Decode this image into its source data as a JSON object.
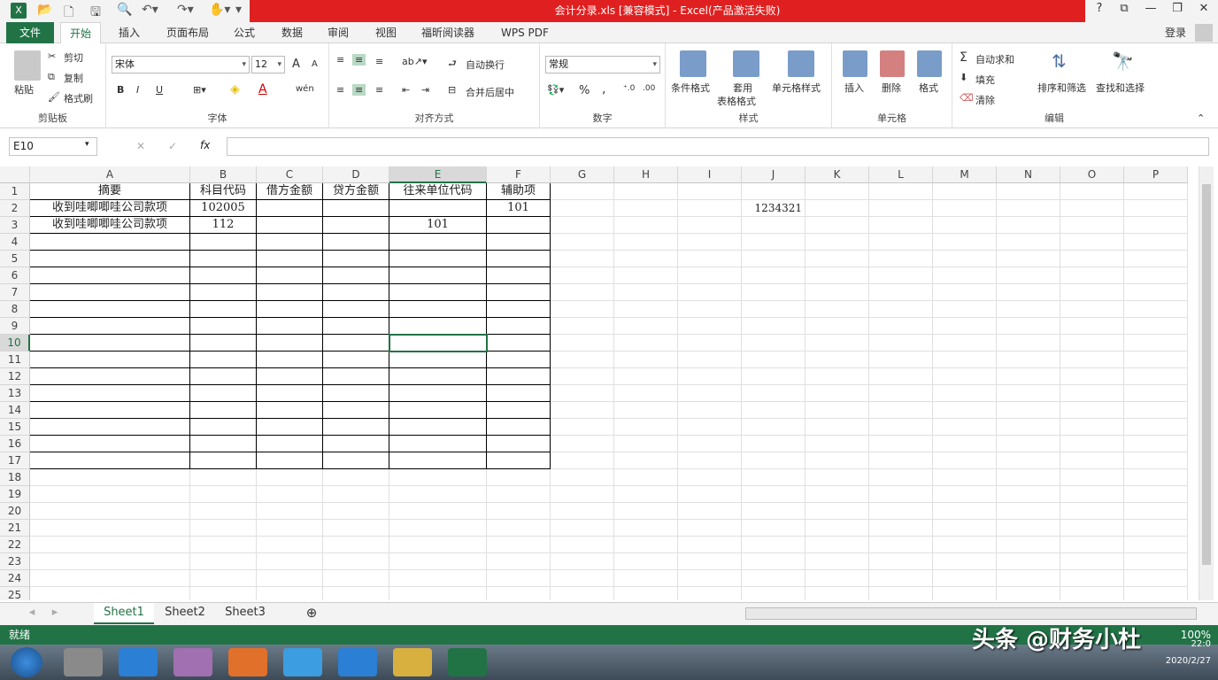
{
  "window": {
    "title": "会计分录.xls  [兼容模式] -  Excel(产品激活失败)",
    "help": "?",
    "login": "登录"
  },
  "tabs": [
    "文件",
    "开始",
    "插入",
    "页面布局",
    "公式",
    "数据",
    "审阅",
    "视图",
    "福昕阅读器",
    "WPS PDF"
  ],
  "ribbon": {
    "clipboard": {
      "label": "剪贴板",
      "paste": "粘贴",
      "cut": "剪切",
      "copy": "复制",
      "painter": "格式刷"
    },
    "font": {
      "label": "字体",
      "name": "宋体",
      "size": "12",
      "bold": "B",
      "italic": "I",
      "underline": "U",
      "grow": "A",
      "shrink": "A",
      "phonetic": "wén"
    },
    "align": {
      "label": "对齐方式",
      "wrap": "自动换行",
      "merge": "合并后居中"
    },
    "number": {
      "label": "数字",
      "format": "常规",
      "percent": "%",
      "comma": ","
    },
    "styles": {
      "label": "样式",
      "cond": "条件格式",
      "table1": "套用",
      "table2": "表格格式",
      "cell": "单元格样式"
    },
    "cells": {
      "label": "单元格",
      "insert": "插入",
      "delete": "删除",
      "format": "格式"
    },
    "edit": {
      "label": "编辑",
      "autosum": "自动求和",
      "fill": "填充",
      "clear": "清除",
      "sort": "排序和筛选",
      "find": "查找和选择"
    }
  },
  "formula": {
    "namebox": "E10",
    "fx": "fx",
    "cancel": "✕",
    "confirm": "✓"
  },
  "columns": [
    "A",
    "B",
    "C",
    "D",
    "E",
    "F",
    "G",
    "H",
    "I",
    "J",
    "K",
    "L",
    "M",
    "N",
    "O",
    "P"
  ],
  "rows": [
    "1",
    "2",
    "3",
    "4",
    "5",
    "6",
    "7",
    "8",
    "9",
    "10",
    "11",
    "12",
    "13",
    "14",
    "15",
    "16",
    "17",
    "18",
    "19",
    "20",
    "21",
    "22",
    "23",
    "24",
    "25"
  ],
  "cells": {
    "A1": "摘要",
    "B1": "科目代码",
    "C1": "借方金额",
    "D1": "贷方金额",
    "E1": "往来单位代码",
    "F1": "辅助项",
    "A2": "收到哇唧唧哇公司款项",
    "B2": "102005",
    "F2": "101",
    "J2": "1234321",
    "A3": "收到哇唧唧哇公司款项",
    "B3": "112",
    "E3": "101"
  },
  "sheets": [
    "Sheet1",
    "Sheet2",
    "Sheet3"
  ],
  "status": {
    "ready": "就绪",
    "zoom": "100%"
  },
  "watermark": "头条 @财务小杜",
  "clock": {
    "time": "22:0",
    "date": "2020/2/27"
  }
}
